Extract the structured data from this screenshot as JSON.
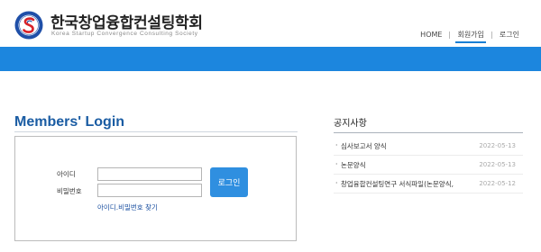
{
  "brand": {
    "title": "한국창업융합컨설팅학회",
    "subtitle": "Korea Startup Convergence Consulting Society",
    "emblem_color": "#1f4fa8",
    "accent_red": "#d8232a"
  },
  "nav": {
    "items": [
      {
        "label": "HOME"
      },
      {
        "label": "회원가입",
        "active": true
      },
      {
        "label": "로그인"
      }
    ]
  },
  "colors": {
    "band": "#1c86de",
    "button": "#2f8fe0",
    "heading": "#1a5ca3"
  },
  "login": {
    "heading": "Members' Login",
    "id_label": "아이디",
    "pw_label": "비밀번호",
    "id_value": "",
    "pw_value": "",
    "button_label": "로그인",
    "find_link": "아이디.비밀번호 찾기"
  },
  "notice": {
    "title": "공지사항",
    "items": [
      {
        "title": "심사보고서 양식",
        "date": "2022-05-13"
      },
      {
        "title": "논문양식",
        "date": "2022-05-13"
      },
      {
        "title": "창업융합컨설팅연구 서식파일(논문양식,",
        "date": "2022-05-12"
      }
    ]
  }
}
